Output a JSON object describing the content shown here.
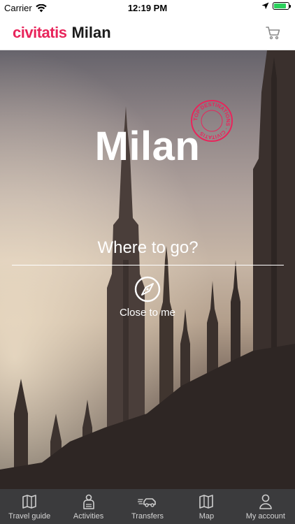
{
  "status_bar": {
    "carrier": "Carrier",
    "time": "12:19 PM",
    "battery_level": 0.85
  },
  "header": {
    "brand": "civitatis",
    "city": "Milan",
    "cart_icon": "cart-icon"
  },
  "hero": {
    "title": "Milan",
    "stamp_text": "TOP DESTINATIONS · CIVITATIS ·",
    "search": {
      "placeholder": "Where to go?",
      "value": ""
    },
    "near_me_label": "Close to me"
  },
  "tabs": [
    {
      "label": "Travel guide",
      "icon": "map-guide-icon"
    },
    {
      "label": "Activities",
      "icon": "person-icon"
    },
    {
      "label": "Transfers",
      "icon": "car-icon"
    },
    {
      "label": "Map",
      "icon": "map-icon"
    },
    {
      "label": "My account",
      "icon": "account-icon"
    }
  ],
  "colors": {
    "brand": "#e8255b",
    "tab_bar": "#3b3b3d",
    "battery": "#2bd15c"
  }
}
